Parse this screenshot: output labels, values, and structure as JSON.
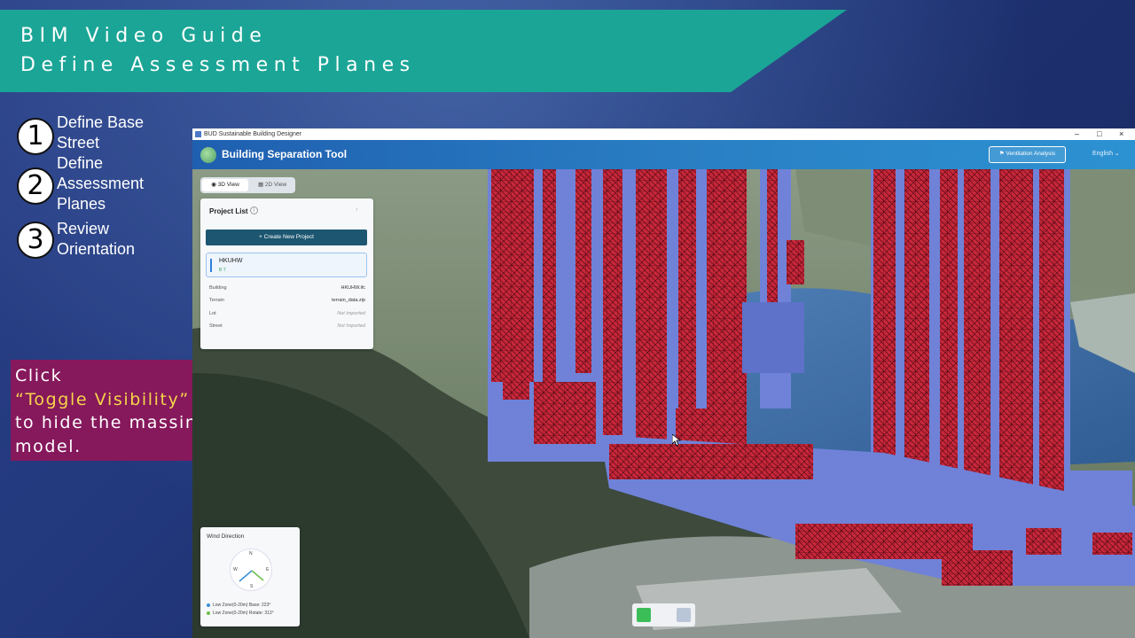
{
  "banner": {
    "line1": "BIM Video Guide",
    "line2": "Define Assessment Planes"
  },
  "steps": [
    {
      "num": "1",
      "text": "Define Base Street"
    },
    {
      "num": "2",
      "text": "Define Assessment Planes"
    },
    {
      "num": "3",
      "text": "Review Orientation"
    }
  ],
  "instruction": {
    "line1": "Click",
    "line2": "“Toggle Visibility”",
    "line3": "to hide the massing",
    "line4": "model."
  },
  "window": {
    "title": "BUD Sustainable Building Designer",
    "minimize": "–",
    "maximize": "□",
    "close": "×"
  },
  "app": {
    "title": "Building Separation Tool",
    "ventilation_button": "Ventilation Analysis",
    "language": "English"
  },
  "view_toggle": {
    "view_3d": "3D View",
    "view_2d": "2D View"
  },
  "project_panel": {
    "title": "Project List",
    "new_project": "Create New Project",
    "project_name": "HKUHW",
    "project_tags": "B T",
    "rows": [
      {
        "key": "Building",
        "value": "HKUHW.ifc"
      },
      {
        "key": "Terrain",
        "value": "terrain_data.zip"
      },
      {
        "key": "Lot",
        "value": "Not Imported"
      },
      {
        "key": "Street",
        "value": "Not Imported"
      }
    ]
  },
  "wind": {
    "title": "Wind Direction",
    "n": "N",
    "e": "E",
    "s": "S",
    "w": "W",
    "legend1": "Low Zone(0-20m) Base: 223°",
    "legend2": "Low Zone(0-20m) Rotate: 313°"
  },
  "colors": {
    "banner": "#1ba596",
    "instruction_box": "#86185c",
    "highlight": "#f5d44a",
    "massing_red": "#c8283a",
    "massing_blue": "#6f82d8",
    "primary_button": "#1c5670"
  }
}
